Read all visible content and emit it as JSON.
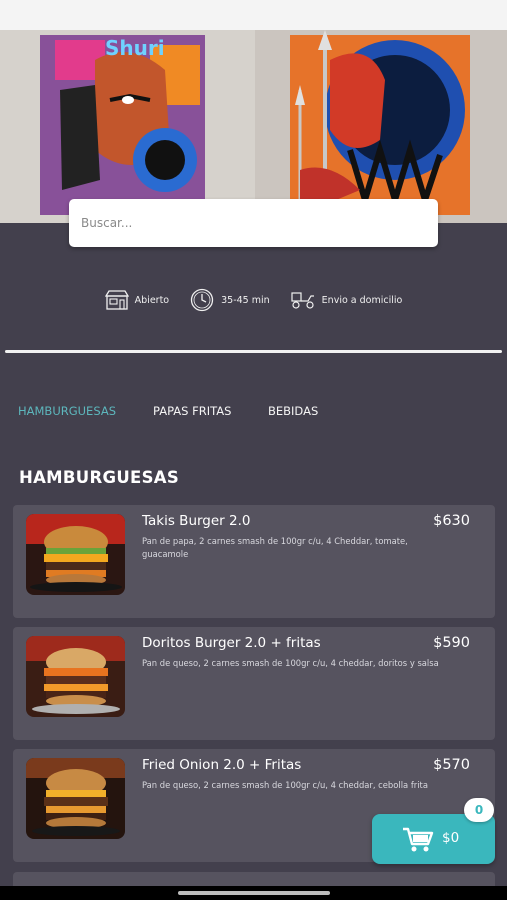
{
  "search": {
    "placeholder": "Buscar..."
  },
  "info": {
    "status": "Abierto",
    "time": "35-45 min",
    "delivery": "Envio a domicilio"
  },
  "tabs": [
    {
      "label": "HAMBURGUESAS",
      "active": true
    },
    {
      "label": "PAPAS FRITAS",
      "active": false
    },
    {
      "label": "BEBIDAS",
      "active": false
    }
  ],
  "section": {
    "title": "HAMBURGUESAS"
  },
  "products": [
    {
      "name": "Takis Burger 2.0",
      "price": "$630",
      "description": "Pan de papa, 2 carnes smash de 100gr c/u, 4 Cheddar, tomate, guacamole"
    },
    {
      "name": "Doritos Burger 2.0 + fritas",
      "price": "$590",
      "description": "Pan de queso, 2 carnes smash de 100gr c/u, 4 cheddar, doritos y salsa"
    },
    {
      "name": "Fried Onion 2.0 + Fritas",
      "price": "$570",
      "description": "Pan de queso, 2 carnes smash de 100gr c/u, 4 cheddar, cebolla frita"
    }
  ],
  "hero": {
    "graffiti_text": "Shuri"
  },
  "cart": {
    "count": "0",
    "total": "$0"
  },
  "colors": {
    "accent": "#3ab7bd",
    "background": "#43404d",
    "card": "#56535f"
  }
}
